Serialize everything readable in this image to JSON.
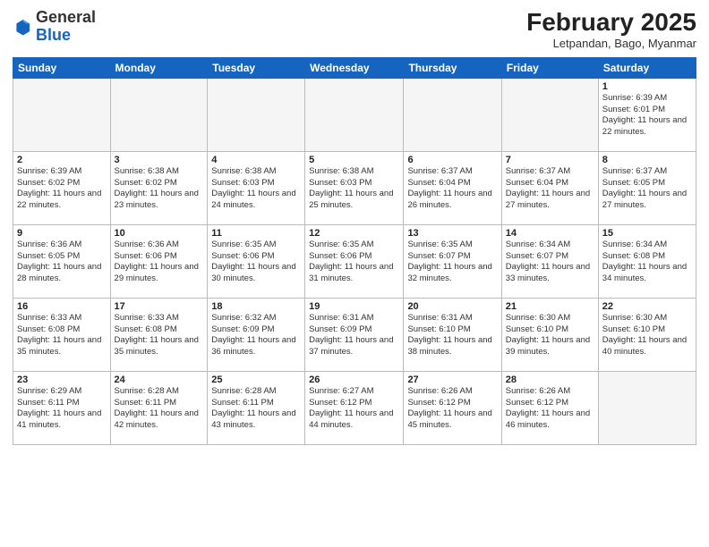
{
  "header": {
    "logo_general": "General",
    "logo_blue": "Blue",
    "month_title": "February 2025",
    "subtitle": "Letpandan, Bago, Myanmar"
  },
  "days_of_week": [
    "Sunday",
    "Monday",
    "Tuesday",
    "Wednesday",
    "Thursday",
    "Friday",
    "Saturday"
  ],
  "weeks": [
    [
      {
        "day": "",
        "info": ""
      },
      {
        "day": "",
        "info": ""
      },
      {
        "day": "",
        "info": ""
      },
      {
        "day": "",
        "info": ""
      },
      {
        "day": "",
        "info": ""
      },
      {
        "day": "",
        "info": ""
      },
      {
        "day": "1",
        "info": "Sunrise: 6:39 AM\nSunset: 6:01 PM\nDaylight: 11 hours\nand 22 minutes."
      }
    ],
    [
      {
        "day": "2",
        "info": "Sunrise: 6:39 AM\nSunset: 6:02 PM\nDaylight: 11 hours\nand 22 minutes."
      },
      {
        "day": "3",
        "info": "Sunrise: 6:38 AM\nSunset: 6:02 PM\nDaylight: 11 hours\nand 23 minutes."
      },
      {
        "day": "4",
        "info": "Sunrise: 6:38 AM\nSunset: 6:03 PM\nDaylight: 11 hours\nand 24 minutes."
      },
      {
        "day": "5",
        "info": "Sunrise: 6:38 AM\nSunset: 6:03 PM\nDaylight: 11 hours\nand 25 minutes."
      },
      {
        "day": "6",
        "info": "Sunrise: 6:37 AM\nSunset: 6:04 PM\nDaylight: 11 hours\nand 26 minutes."
      },
      {
        "day": "7",
        "info": "Sunrise: 6:37 AM\nSunset: 6:04 PM\nDaylight: 11 hours\nand 27 minutes."
      },
      {
        "day": "8",
        "info": "Sunrise: 6:37 AM\nSunset: 6:05 PM\nDaylight: 11 hours\nand 27 minutes."
      }
    ],
    [
      {
        "day": "9",
        "info": "Sunrise: 6:36 AM\nSunset: 6:05 PM\nDaylight: 11 hours\nand 28 minutes."
      },
      {
        "day": "10",
        "info": "Sunrise: 6:36 AM\nSunset: 6:06 PM\nDaylight: 11 hours\nand 29 minutes."
      },
      {
        "day": "11",
        "info": "Sunrise: 6:35 AM\nSunset: 6:06 PM\nDaylight: 11 hours\nand 30 minutes."
      },
      {
        "day": "12",
        "info": "Sunrise: 6:35 AM\nSunset: 6:06 PM\nDaylight: 11 hours\nand 31 minutes."
      },
      {
        "day": "13",
        "info": "Sunrise: 6:35 AM\nSunset: 6:07 PM\nDaylight: 11 hours\nand 32 minutes."
      },
      {
        "day": "14",
        "info": "Sunrise: 6:34 AM\nSunset: 6:07 PM\nDaylight: 11 hours\nand 33 minutes."
      },
      {
        "day": "15",
        "info": "Sunrise: 6:34 AM\nSunset: 6:08 PM\nDaylight: 11 hours\nand 34 minutes."
      }
    ],
    [
      {
        "day": "16",
        "info": "Sunrise: 6:33 AM\nSunset: 6:08 PM\nDaylight: 11 hours\nand 35 minutes."
      },
      {
        "day": "17",
        "info": "Sunrise: 6:33 AM\nSunset: 6:08 PM\nDaylight: 11 hours\nand 35 minutes."
      },
      {
        "day": "18",
        "info": "Sunrise: 6:32 AM\nSunset: 6:09 PM\nDaylight: 11 hours\nand 36 minutes."
      },
      {
        "day": "19",
        "info": "Sunrise: 6:31 AM\nSunset: 6:09 PM\nDaylight: 11 hours\nand 37 minutes."
      },
      {
        "day": "20",
        "info": "Sunrise: 6:31 AM\nSunset: 6:10 PM\nDaylight: 11 hours\nand 38 minutes."
      },
      {
        "day": "21",
        "info": "Sunrise: 6:30 AM\nSunset: 6:10 PM\nDaylight: 11 hours\nand 39 minutes."
      },
      {
        "day": "22",
        "info": "Sunrise: 6:30 AM\nSunset: 6:10 PM\nDaylight: 11 hours\nand 40 minutes."
      }
    ],
    [
      {
        "day": "23",
        "info": "Sunrise: 6:29 AM\nSunset: 6:11 PM\nDaylight: 11 hours\nand 41 minutes."
      },
      {
        "day": "24",
        "info": "Sunrise: 6:28 AM\nSunset: 6:11 PM\nDaylight: 11 hours\nand 42 minutes."
      },
      {
        "day": "25",
        "info": "Sunrise: 6:28 AM\nSunset: 6:11 PM\nDaylight: 11 hours\nand 43 minutes."
      },
      {
        "day": "26",
        "info": "Sunrise: 6:27 AM\nSunset: 6:12 PM\nDaylight: 11 hours\nand 44 minutes."
      },
      {
        "day": "27",
        "info": "Sunrise: 6:26 AM\nSunset: 6:12 PM\nDaylight: 11 hours\nand 45 minutes."
      },
      {
        "day": "28",
        "info": "Sunrise: 6:26 AM\nSunset: 6:12 PM\nDaylight: 11 hours\nand 46 minutes."
      },
      {
        "day": "",
        "info": ""
      }
    ]
  ]
}
